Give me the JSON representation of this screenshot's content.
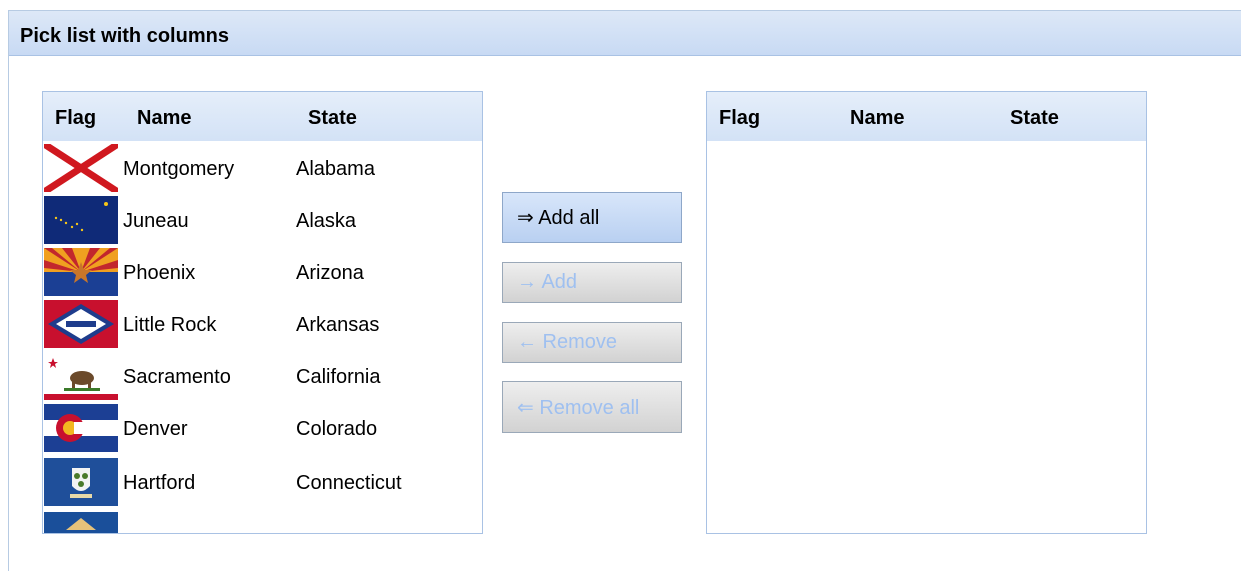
{
  "panel": {
    "title": "Pick list with columns"
  },
  "source_list": {
    "columns": [
      "Flag",
      "Name",
      "State"
    ],
    "rows": [
      {
        "flag": "alabama-flag",
        "name": "Montgomery",
        "state": "Alabama"
      },
      {
        "flag": "alaska-flag",
        "name": "Juneau",
        "state": "Alaska"
      },
      {
        "flag": "arizona-flag",
        "name": "Phoenix",
        "state": "Arizona"
      },
      {
        "flag": "arkansas-flag",
        "name": "Little Rock",
        "state": "Arkansas"
      },
      {
        "flag": "california-flag",
        "name": "Sacramento",
        "state": "California"
      },
      {
        "flag": "colorado-flag",
        "name": "Denver",
        "state": "Colorado"
      },
      {
        "flag": "connecticut-flag",
        "name": "Hartford",
        "state": "Connecticut"
      },
      {
        "flag": "delaware-flag",
        "name": "",
        "state": ""
      }
    ]
  },
  "target_list": {
    "columns": [
      "Flag",
      "Name",
      "State"
    ],
    "rows": []
  },
  "buttons": {
    "add_all": "⇒ Add all",
    "add": "→ Add",
    "remove": "← Remove",
    "remove_all": "⇐ Remove all"
  },
  "colors": {
    "header_bg": "#c8daf4",
    "border": "#a9c2e4",
    "button_enabled": "#b9d0f1",
    "button_disabled": "#d2d2d2",
    "disabled_text": "#9fc0f0"
  }
}
